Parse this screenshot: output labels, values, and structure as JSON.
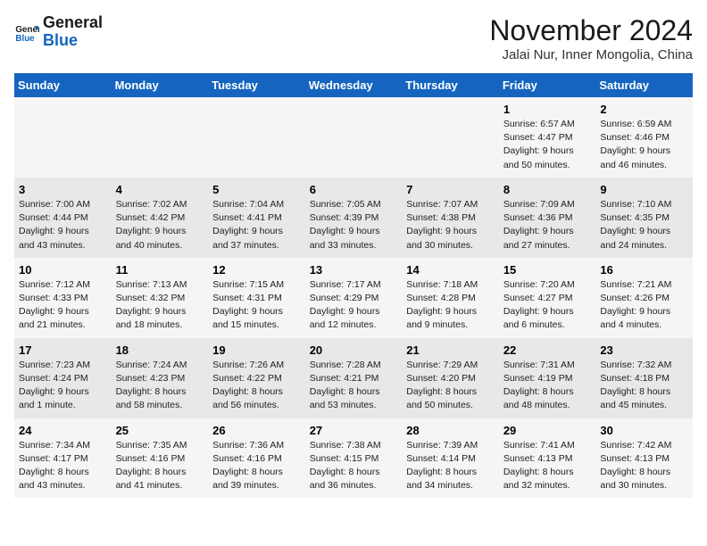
{
  "logo": {
    "line1": "General",
    "line2": "Blue"
  },
  "title": "November 2024",
  "location": "Jalai Nur, Inner Mongolia, China",
  "weekdays": [
    "Sunday",
    "Monday",
    "Tuesday",
    "Wednesday",
    "Thursday",
    "Friday",
    "Saturday"
  ],
  "weeks": [
    [
      {
        "day": "",
        "info": ""
      },
      {
        "day": "",
        "info": ""
      },
      {
        "day": "",
        "info": ""
      },
      {
        "day": "",
        "info": ""
      },
      {
        "day": "",
        "info": ""
      },
      {
        "day": "1",
        "info": "Sunrise: 6:57 AM\nSunset: 4:47 PM\nDaylight: 9 hours and 50 minutes."
      },
      {
        "day": "2",
        "info": "Sunrise: 6:59 AM\nSunset: 4:46 PM\nDaylight: 9 hours and 46 minutes."
      }
    ],
    [
      {
        "day": "3",
        "info": "Sunrise: 7:00 AM\nSunset: 4:44 PM\nDaylight: 9 hours and 43 minutes."
      },
      {
        "day": "4",
        "info": "Sunrise: 7:02 AM\nSunset: 4:42 PM\nDaylight: 9 hours and 40 minutes."
      },
      {
        "day": "5",
        "info": "Sunrise: 7:04 AM\nSunset: 4:41 PM\nDaylight: 9 hours and 37 minutes."
      },
      {
        "day": "6",
        "info": "Sunrise: 7:05 AM\nSunset: 4:39 PM\nDaylight: 9 hours and 33 minutes."
      },
      {
        "day": "7",
        "info": "Sunrise: 7:07 AM\nSunset: 4:38 PM\nDaylight: 9 hours and 30 minutes."
      },
      {
        "day": "8",
        "info": "Sunrise: 7:09 AM\nSunset: 4:36 PM\nDaylight: 9 hours and 27 minutes."
      },
      {
        "day": "9",
        "info": "Sunrise: 7:10 AM\nSunset: 4:35 PM\nDaylight: 9 hours and 24 minutes."
      }
    ],
    [
      {
        "day": "10",
        "info": "Sunrise: 7:12 AM\nSunset: 4:33 PM\nDaylight: 9 hours and 21 minutes."
      },
      {
        "day": "11",
        "info": "Sunrise: 7:13 AM\nSunset: 4:32 PM\nDaylight: 9 hours and 18 minutes."
      },
      {
        "day": "12",
        "info": "Sunrise: 7:15 AM\nSunset: 4:31 PM\nDaylight: 9 hours and 15 minutes."
      },
      {
        "day": "13",
        "info": "Sunrise: 7:17 AM\nSunset: 4:29 PM\nDaylight: 9 hours and 12 minutes."
      },
      {
        "day": "14",
        "info": "Sunrise: 7:18 AM\nSunset: 4:28 PM\nDaylight: 9 hours and 9 minutes."
      },
      {
        "day": "15",
        "info": "Sunrise: 7:20 AM\nSunset: 4:27 PM\nDaylight: 9 hours and 6 minutes."
      },
      {
        "day": "16",
        "info": "Sunrise: 7:21 AM\nSunset: 4:26 PM\nDaylight: 9 hours and 4 minutes."
      }
    ],
    [
      {
        "day": "17",
        "info": "Sunrise: 7:23 AM\nSunset: 4:24 PM\nDaylight: 9 hours and 1 minute."
      },
      {
        "day": "18",
        "info": "Sunrise: 7:24 AM\nSunset: 4:23 PM\nDaylight: 8 hours and 58 minutes."
      },
      {
        "day": "19",
        "info": "Sunrise: 7:26 AM\nSunset: 4:22 PM\nDaylight: 8 hours and 56 minutes."
      },
      {
        "day": "20",
        "info": "Sunrise: 7:28 AM\nSunset: 4:21 PM\nDaylight: 8 hours and 53 minutes."
      },
      {
        "day": "21",
        "info": "Sunrise: 7:29 AM\nSunset: 4:20 PM\nDaylight: 8 hours and 50 minutes."
      },
      {
        "day": "22",
        "info": "Sunrise: 7:31 AM\nSunset: 4:19 PM\nDaylight: 8 hours and 48 minutes."
      },
      {
        "day": "23",
        "info": "Sunrise: 7:32 AM\nSunset: 4:18 PM\nDaylight: 8 hours and 45 minutes."
      }
    ],
    [
      {
        "day": "24",
        "info": "Sunrise: 7:34 AM\nSunset: 4:17 PM\nDaylight: 8 hours and 43 minutes."
      },
      {
        "day": "25",
        "info": "Sunrise: 7:35 AM\nSunset: 4:16 PM\nDaylight: 8 hours and 41 minutes."
      },
      {
        "day": "26",
        "info": "Sunrise: 7:36 AM\nSunset: 4:16 PM\nDaylight: 8 hours and 39 minutes."
      },
      {
        "day": "27",
        "info": "Sunrise: 7:38 AM\nSunset: 4:15 PM\nDaylight: 8 hours and 36 minutes."
      },
      {
        "day": "28",
        "info": "Sunrise: 7:39 AM\nSunset: 4:14 PM\nDaylight: 8 hours and 34 minutes."
      },
      {
        "day": "29",
        "info": "Sunrise: 7:41 AM\nSunset: 4:13 PM\nDaylight: 8 hours and 32 minutes."
      },
      {
        "day": "30",
        "info": "Sunrise: 7:42 AM\nSunset: 4:13 PM\nDaylight: 8 hours and 30 minutes."
      }
    ]
  ]
}
